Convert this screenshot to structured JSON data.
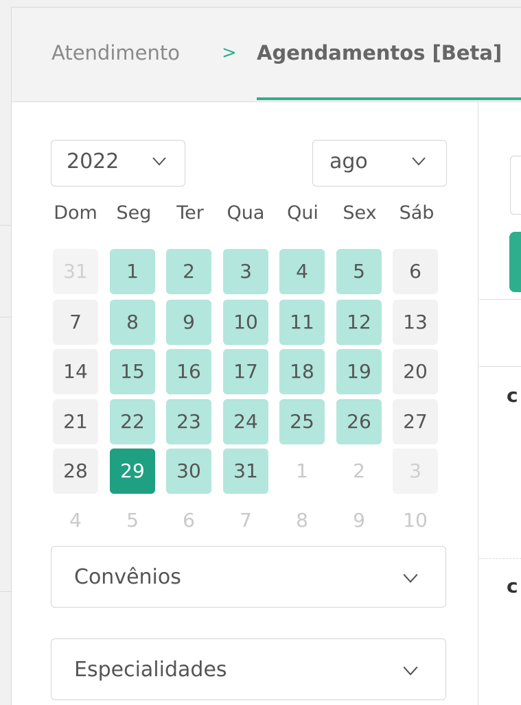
{
  "breadcrumb": {
    "parent": "Atendimento",
    "separator": ">",
    "current": "Agendamentos [Beta]"
  },
  "calendar": {
    "year": "2022",
    "month": "ago",
    "weekdays": [
      "Dom",
      "Seg",
      "Ter",
      "Qua",
      "Qui",
      "Sex",
      "Sáb"
    ],
    "selected_day": "29",
    "weeks": [
      [
        {
          "n": "31",
          "s": "other"
        },
        {
          "n": "1",
          "s": "avail"
        },
        {
          "n": "2",
          "s": "avail"
        },
        {
          "n": "3",
          "s": "avail"
        },
        {
          "n": "4",
          "s": "avail"
        },
        {
          "n": "5",
          "s": "avail"
        },
        {
          "n": "6",
          "s": "weekend"
        }
      ],
      [
        {
          "n": "7",
          "s": "weekend"
        },
        {
          "n": "8",
          "s": "avail"
        },
        {
          "n": "9",
          "s": "avail"
        },
        {
          "n": "10",
          "s": "avail"
        },
        {
          "n": "11",
          "s": "avail"
        },
        {
          "n": "12",
          "s": "avail"
        },
        {
          "n": "13",
          "s": "weekend"
        }
      ],
      [
        {
          "n": "14",
          "s": "weekend"
        },
        {
          "n": "15",
          "s": "avail"
        },
        {
          "n": "16",
          "s": "avail"
        },
        {
          "n": "17",
          "s": "avail"
        },
        {
          "n": "18",
          "s": "avail"
        },
        {
          "n": "19",
          "s": "avail"
        },
        {
          "n": "20",
          "s": "weekend"
        }
      ],
      [
        {
          "n": "21",
          "s": "weekend"
        },
        {
          "n": "22",
          "s": "avail"
        },
        {
          "n": "23",
          "s": "avail"
        },
        {
          "n": "24",
          "s": "avail"
        },
        {
          "n": "25",
          "s": "avail"
        },
        {
          "n": "26",
          "s": "avail"
        },
        {
          "n": "27",
          "s": "weekend"
        }
      ],
      [
        {
          "n": "28",
          "s": "weekend"
        },
        {
          "n": "29",
          "s": "selected"
        },
        {
          "n": "30",
          "s": "avail"
        },
        {
          "n": "31",
          "s": "avail"
        },
        {
          "n": "1",
          "s": "other"
        },
        {
          "n": "2",
          "s": "other"
        },
        {
          "n": "3",
          "s": "other"
        }
      ],
      [
        {
          "n": "4",
          "s": "other"
        },
        {
          "n": "5",
          "s": "other"
        },
        {
          "n": "6",
          "s": "other"
        },
        {
          "n": "7",
          "s": "other"
        },
        {
          "n": "8",
          "s": "other"
        },
        {
          "n": "9",
          "s": "other"
        },
        {
          "n": "10",
          "s": "other"
        }
      ]
    ]
  },
  "filters": {
    "convenios_label": "Convênios",
    "especialidades_label": "Especialidades"
  },
  "right_panel": {
    "truncated_char_1": "c",
    "truncated_char_2": "c"
  },
  "colors": {
    "accent": "#2fae8e",
    "available_day": "#b3e6dc",
    "selected_day": "#1fa082",
    "weekend_day": "#f2f2f2"
  },
  "icons": {
    "breadcrumb_separator": "chevron-right-icon",
    "dropdown": "chevron-down-icon"
  }
}
